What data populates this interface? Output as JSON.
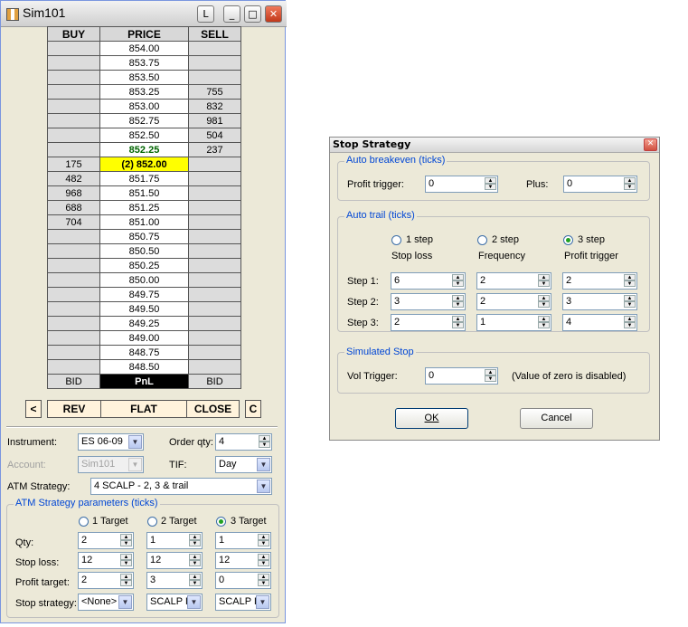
{
  "window": {
    "title": "Sim101",
    "btn_l": "L",
    "btn_min": "_",
    "btn_max": "□",
    "btn_close": "✕"
  },
  "ladder": {
    "headers": {
      "buy": "BUY",
      "price": "PRICE",
      "sell": "SELL"
    },
    "rows": [
      {
        "buy": "",
        "price": "854.00",
        "sell": ""
      },
      {
        "buy": "",
        "price": "853.75",
        "sell": ""
      },
      {
        "buy": "",
        "price": "853.50",
        "sell": ""
      },
      {
        "buy": "",
        "price": "853.25",
        "sell": "755"
      },
      {
        "buy": "",
        "price": "853.00",
        "sell": "832"
      },
      {
        "buy": "",
        "price": "852.75",
        "sell": "981"
      },
      {
        "buy": "",
        "price": "852.50",
        "sell": "504"
      },
      {
        "buy": "",
        "price": "852.25",
        "sell": "237"
      },
      {
        "buy": "175",
        "price": "(2) 852.00",
        "sell": ""
      },
      {
        "buy": "482",
        "price": "851.75",
        "sell": ""
      },
      {
        "buy": "968",
        "price": "851.50",
        "sell": ""
      },
      {
        "buy": "688",
        "price": "851.25",
        "sell": ""
      },
      {
        "buy": "704",
        "price": "851.00",
        "sell": ""
      },
      {
        "buy": "",
        "price": "850.75",
        "sell": ""
      },
      {
        "buy": "",
        "price": "850.50",
        "sell": ""
      },
      {
        "buy": "",
        "price": "850.25",
        "sell": ""
      },
      {
        "buy": "",
        "price": "850.00",
        "sell": ""
      },
      {
        "buy": "",
        "price": "849.75",
        "sell": ""
      },
      {
        "buy": "",
        "price": "849.50",
        "sell": ""
      },
      {
        "buy": "",
        "price": "849.25",
        "sell": ""
      },
      {
        "buy": "",
        "price": "849.00",
        "sell": ""
      },
      {
        "buy": "",
        "price": "848.75",
        "sell": ""
      },
      {
        "buy": "",
        "price": "848.50",
        "sell": ""
      }
    ],
    "footer": {
      "bid": "BID",
      "pnl": "PnL",
      "ask": "BID"
    }
  },
  "actions": {
    "left": "<",
    "rev": "REV",
    "flat": "FLAT",
    "close": "CLOSE",
    "right": "C"
  },
  "form": {
    "instrument_label": "Instrument:",
    "instrument_value": "ES 06-09",
    "orderqty_label": "Order qty:",
    "orderqty_value": "4",
    "account_label": "Account:",
    "account_value": "Sim101",
    "tif_label": "TIF:",
    "tif_value": "Day",
    "atm_label": "ATM Strategy:",
    "atm_value": "4 SCALP - 2, 3 & trail",
    "params_legend": "ATM Strategy parameters (ticks)",
    "targets": [
      "1 Target",
      "2 Target",
      "3 Target"
    ],
    "qty_label": "Qty:",
    "qty": [
      "2",
      "1",
      "1"
    ],
    "stoploss_label": "Stop loss:",
    "stoploss": [
      "12",
      "12",
      "12"
    ],
    "profittarget_label": "Profit target:",
    "profittarget": [
      "2",
      "3",
      "0"
    ],
    "stopstrategy_label": "Stop strategy:",
    "stopstrategy": [
      "<None>",
      "SCALP I",
      "SCALP I"
    ]
  },
  "dialog": {
    "title": "Stop Strategy",
    "breakeven_legend": "Auto breakeven (ticks)",
    "profit_trigger_label": "Profit trigger:",
    "profit_trigger_value": "0",
    "plus_label": "Plus:",
    "plus_value": "0",
    "trail_legend": "Auto trail (ticks)",
    "steps": [
      "1 step",
      "2 step",
      "3 step"
    ],
    "col_headers": [
      "Stop loss",
      "Frequency",
      "Profit trigger"
    ],
    "step_labels": [
      "Step 1:",
      "Step 2:",
      "Step 3:"
    ],
    "step_values": [
      [
        "6",
        "2",
        "2"
      ],
      [
        "3",
        "2",
        "3"
      ],
      [
        "2",
        "1",
        "4"
      ]
    ],
    "sim_legend": "Simulated Stop",
    "vol_trigger_label": "Vol Trigger:",
    "vol_trigger_value": "0",
    "vol_note": "(Value of zero is disabled)",
    "ok": "OK",
    "cancel": "Cancel"
  },
  "colors": {
    "last_price": "#006400",
    "position_highlight": "#ffff00",
    "accent": "#0046d5"
  }
}
